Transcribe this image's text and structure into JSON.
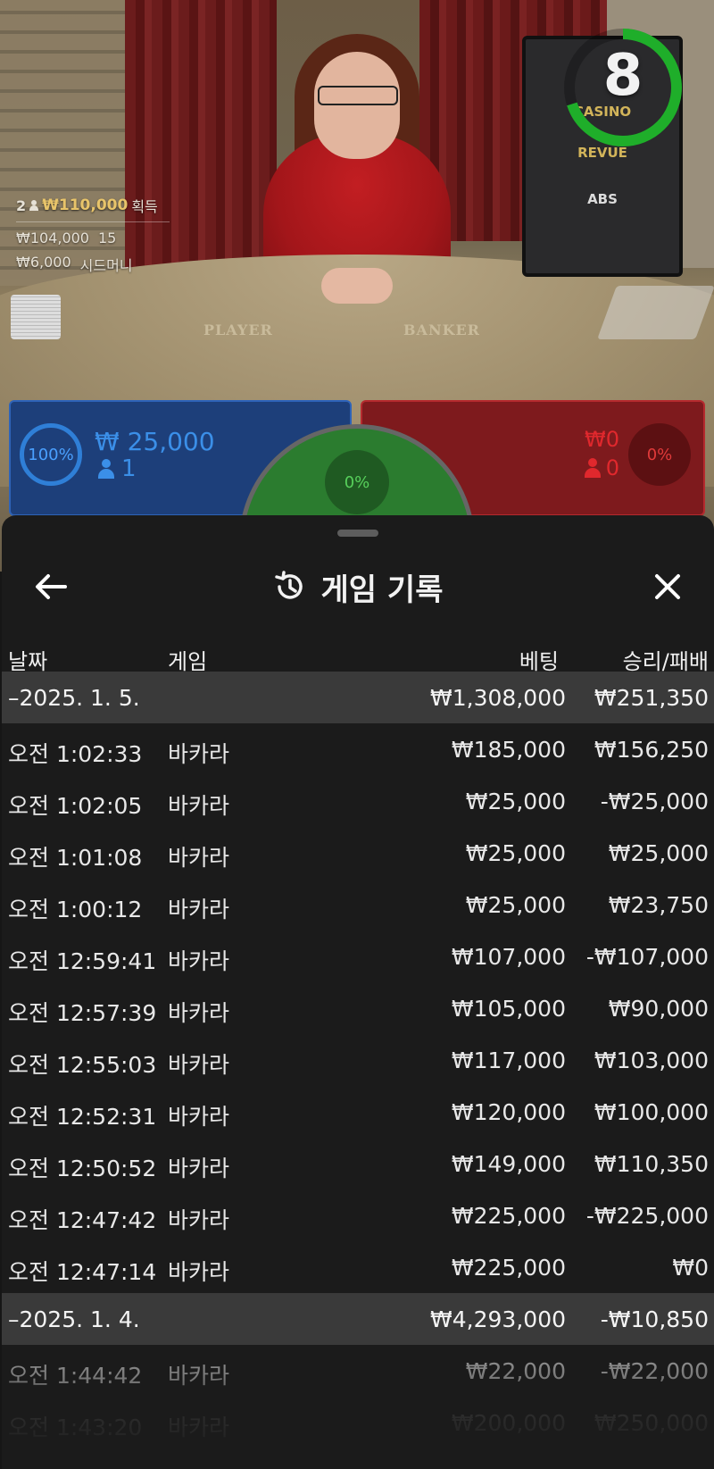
{
  "video": {
    "table_words": [
      "PLAYER",
      "BANKER"
    ],
    "stats": {
      "players": "2",
      "winnings": "₩110,000",
      "winnings_label": "획득",
      "total_bets": "₩104,000",
      "bettors": "15",
      "seed_amount": "₩6,000",
      "seed_label": "시드머니"
    },
    "timer": "8",
    "timer_progress": 0.7,
    "sign_logos": [
      "CASINO",
      "REVUE",
      "ABS"
    ]
  },
  "bets": {
    "player": {
      "percent": "100%",
      "amount": "₩ 25,000",
      "count": "1"
    },
    "tie": {
      "percent": "0%"
    },
    "banker": {
      "percent": "0%",
      "amount": "₩0",
      "count": "0"
    }
  },
  "history": {
    "title": "게임 기록",
    "columns": {
      "date": "날짜",
      "game": "게임",
      "bet": "베팅",
      "result": "승리/패배"
    },
    "groups": [
      {
        "date": "–2025. 1. 5.",
        "bet_total": "₩1,308,000",
        "result_total": "₩251,350",
        "items": [
          {
            "time": "오전 1:02:33",
            "game": "바카라",
            "bet": "₩185,000",
            "result": "₩156,250"
          },
          {
            "time": "오전 1:02:05",
            "game": "바카라",
            "bet": "₩25,000",
            "result": "-₩25,000"
          },
          {
            "time": "오전 1:01:08",
            "game": "바카라",
            "bet": "₩25,000",
            "result": "₩25,000"
          },
          {
            "time": "오전 1:00:12",
            "game": "바카라",
            "bet": "₩25,000",
            "result": "₩23,750"
          },
          {
            "time": "오전 12:59:41",
            "game": "바카라",
            "bet": "₩107,000",
            "result": "-₩107,000"
          },
          {
            "time": "오전 12:57:39",
            "game": "바카라",
            "bet": "₩105,000",
            "result": "₩90,000"
          },
          {
            "time": "오전 12:55:03",
            "game": "바카라",
            "bet": "₩117,000",
            "result": "₩103,000"
          },
          {
            "time": "오전 12:52:31",
            "game": "바카라",
            "bet": "₩120,000",
            "result": "₩100,000"
          },
          {
            "time": "오전 12:50:52",
            "game": "바카라",
            "bet": "₩149,000",
            "result": "₩110,350"
          },
          {
            "time": "오전 12:47:42",
            "game": "바카라",
            "bet": "₩225,000",
            "result": "-₩225,000"
          },
          {
            "time": "오전 12:47:14",
            "game": "바카라",
            "bet": "₩225,000",
            "result": "₩0"
          }
        ]
      },
      {
        "date": "–2025. 1. 4.",
        "bet_total": "₩4,293,000",
        "result_total": "-₩10,850",
        "items": [
          {
            "time": "오전 1:44:42",
            "game": "바카라",
            "bet": "₩22,000",
            "result": "-₩22,000"
          },
          {
            "time": "오전 1:43:20",
            "game": "바카라",
            "bet": "₩200,000",
            "result": "₩250,000"
          }
        ]
      }
    ]
  },
  "icons": {
    "back": "arrow-left-icon",
    "history": "history-icon",
    "close": "close-icon"
  },
  "colors": {
    "player": "#1d3f7a",
    "banker": "#7e1a1d",
    "tie": "#2b7c2f",
    "sheet": "#1b1b1b",
    "timer": "#1fae2a"
  }
}
